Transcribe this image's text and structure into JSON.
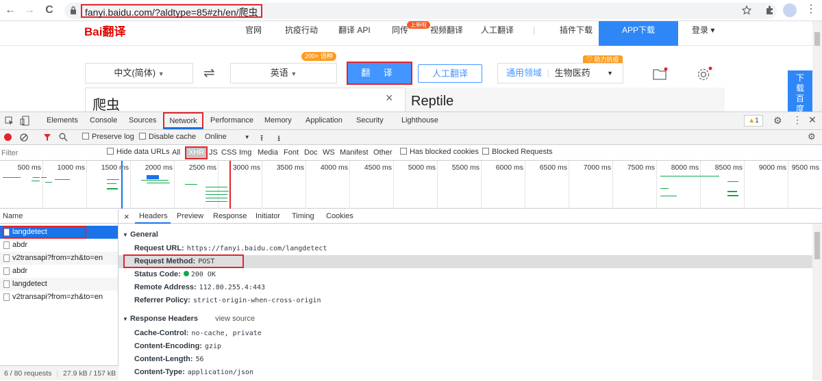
{
  "browser": {
    "url": "fanyi.baidu.com/?aldtype=85#zh/en/爬虫",
    "back": "←",
    "forward": "→",
    "reload": "C"
  },
  "baidu": {
    "logo_text": "Bai翻译",
    "nav": [
      "官网",
      "抗疫行动",
      "翻译 API",
      "同传",
      "视频翻译",
      "人工翻译",
      "|",
      "插件下载"
    ],
    "nav_badge": "上新啦",
    "app_download": "APP下载",
    "login": "登录",
    "badge_langs": "200+ 语种",
    "badge_help": "助力抗疫",
    "src_lang": "中文(简体)",
    "dst_lang": "英语",
    "swap": "⇌",
    "translate_btn": "翻 译",
    "human_translate_btn": "人工翻译",
    "domain_label": "通用领域",
    "domain_value": "生物医药",
    "source_text": "爬虫",
    "clear": "×",
    "result_text": "Reptile",
    "side_download": "下载百度"
  },
  "devtools": {
    "tabs": [
      "Elements",
      "Console",
      "Sources",
      "Network",
      "Performance",
      "Memory",
      "Application",
      "Security",
      "Lighthouse"
    ],
    "active_tab": "Network",
    "warning_count": "1",
    "preserve_log": "Preserve log",
    "disable_cache": "Disable cache",
    "throttle": "Online",
    "filter_placeholder": "Filter",
    "hide_data_urls": "Hide data URLs",
    "types": [
      "All",
      "XHR",
      "JS",
      "CSS",
      "Img",
      "Media",
      "Font",
      "Doc",
      "WS",
      "Manifest",
      "Other"
    ],
    "active_type": "XHR",
    "has_blocked_cookies": "Has blocked cookies",
    "blocked_requests": "Blocked Requests",
    "timeline_ticks": [
      "500 ms",
      "1000 ms",
      "1500 ms",
      "2000 ms",
      "2500 ms",
      "3000 ms",
      "3500 ms",
      "4000 ms",
      "4500 ms",
      "5000 ms",
      "5500 ms",
      "6000 ms",
      "6500 ms",
      "7000 ms",
      "7500 ms",
      "8000 ms",
      "8500 ms",
      "9000 ms",
      "9500 ms"
    ],
    "list_header": "Name",
    "requests": [
      "langdetect",
      "abdr",
      "v2transapi?from=zh&to=en",
      "abdr",
      "langdetect",
      "v2transapi?from=zh&to=en"
    ],
    "footer_requests": "6 / 80 requests",
    "footer_size": "27.9 kB / 157 kB",
    "detail_close": "×",
    "detail_tabs": [
      "Headers",
      "Preview",
      "Response",
      "Initiator",
      "Timing",
      "Cookies"
    ],
    "general": {
      "title": "General",
      "rows": [
        {
          "key": "Request URL:",
          "value": "https://fanyi.baidu.com/langdetect"
        },
        {
          "key": "Request Method:",
          "value": "POST"
        },
        {
          "key": "Status Code:",
          "value": "200 OK"
        },
        {
          "key": "Remote Address:",
          "value": "112.80.255.4:443"
        },
        {
          "key": "Referrer Policy:",
          "value": "strict-origin-when-cross-origin"
        }
      ]
    },
    "response_headers": {
      "title": "Response Headers",
      "view_source": "view source",
      "rows": [
        {
          "key": "Cache-Control:",
          "value": "no-cache, private"
        },
        {
          "key": "Content-Encoding:",
          "value": "gzip"
        },
        {
          "key": "Content-Length:",
          "value": "56"
        },
        {
          "key": "Content-Type:",
          "value": "application/json"
        }
      ]
    }
  },
  "colors": {
    "accent": "#1a73e8",
    "highlight_red": "#e2242d",
    "baidu_blue": "#2f87f7",
    "status_ok": "#0fa94a"
  }
}
